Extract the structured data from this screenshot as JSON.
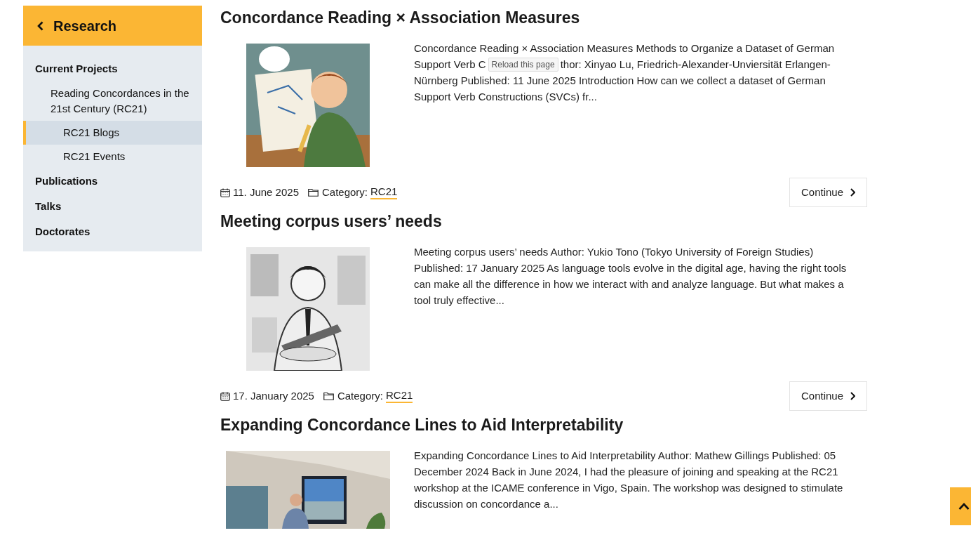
{
  "sidebar": {
    "back_label": "Research",
    "items": [
      {
        "label": "Current Projects",
        "selected": false,
        "children": [
          {
            "label": "Reading Concordances in the 21st Century (RC21)",
            "selected": false,
            "children": [
              {
                "label": "RC21 Blogs",
                "selected": true
              },
              {
                "label": "RC21 Events",
                "selected": false
              }
            ]
          }
        ]
      },
      {
        "label": "Publications",
        "selected": false
      },
      {
        "label": "Talks",
        "selected": false
      },
      {
        "label": "Doctorates",
        "selected": false
      }
    ]
  },
  "posts": [
    {
      "title": "Concordance Reading × Association Measures",
      "excerpt": "Concordance Reading × Association Measures Methods to Organize a Dataset of German",
      "excerpt_left": "Support Verb C",
      "tooltip": "Reload this page",
      "excerpt_right": "thor: Xinyao Lu, Friedrich-Alexander-Unviersität Erlangen-",
      "excerpt_after": "Nürnberg Published: 11 June 2025 Introduction How can we collect a dataset of German Support Verb Constructions (SVCs) fr...",
      "date": "11. June 2025",
      "category_label": "Category:",
      "category": "RC21",
      "continue": "Continue"
    },
    {
      "title": "Meeting corpus users’ needs",
      "excerpt": "Meeting corpus users’ needs Author: Yukio Tono (Tokyo University of Foreign Studies) Published: 17 January 2025 As language tools evolve in the digital age, having the right tools can make all the difference in how we interact with and analyze language. But what makes a tool truly effective...",
      "date": "17. January 2025",
      "category_label": "Category:",
      "category": "RC21",
      "continue": "Continue"
    },
    {
      "title": "Expanding Concordance Lines to Aid Interpretability",
      "excerpt": "Expanding Concordance Lines to Aid Interpretability Author: Mathew Gillings Published: 05 December 2024 Back in June 2024, I had the pleasure of joining and speaking at the RC21 workshop at the ICAME conference in Vigo, Spain. The workshop was designed to stimulate discussion on concordance a..."
    }
  ]
}
